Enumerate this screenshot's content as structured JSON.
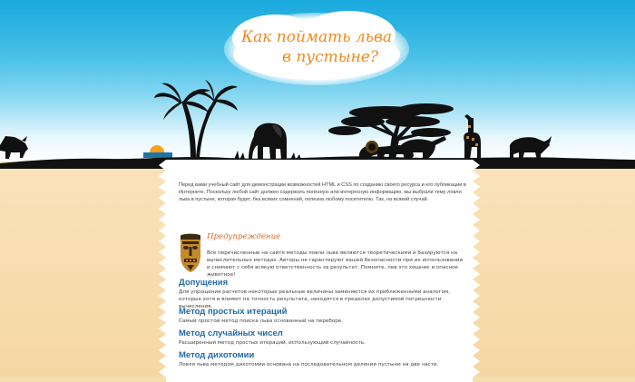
{
  "header": {
    "title_line1": "Как поймать льва",
    "title_line2": "в пустыне?"
  },
  "intro": "Перед вами учебный сайт для демонстрации возможностей HTML и CSS по созданию своего ресурса и его публикации в Интернете. Поскольку любой сайт должен содержать полезную или интересную информацию, мы выбрали тему ловли льва в пустыне, которая будет, без всяких сомнений, полезна любому посетителю. Так, на всякий случай.",
  "warning": {
    "title": "Предупреждение",
    "text": "Все перечисленные на сайте методы ловли льва являются теоретическими и базируются на вычислительных методах. Авторы не гарантируют вашей безопасности при их использовании и снимают с себя всякую ответственность за результат. Помните, лев это хищник и опасное животное!"
  },
  "sections": [
    {
      "heading": "Допущения",
      "text": "Для упрощения расчетов некоторые реальные величины заменяются их приближенными аналогом, которые хотя и влияют на точность результата, находятся в пределах допустимой погрешности вычисления."
    },
    {
      "heading": "Метод простых итераций",
      "text": "Самый простой метод поиска льва основанный на переборе."
    },
    {
      "heading": "Метод случайных чисел",
      "text": "Расширенный метод простых итераций, использующий случайность."
    },
    {
      "heading": "Метод дихотомии",
      "text": "Ловля льва методом дихотомии основана на последовательном делении пустыни на две части."
    }
  ],
  "colors": {
    "sky_top": "#19a9dc",
    "sand": "#f7deb0",
    "title": "#ee8a1c",
    "warning_title": "#e2651e",
    "heading": "#1f6aa8",
    "silhouette": "#111111"
  },
  "icons": {
    "warning": "african-mask-icon"
  }
}
